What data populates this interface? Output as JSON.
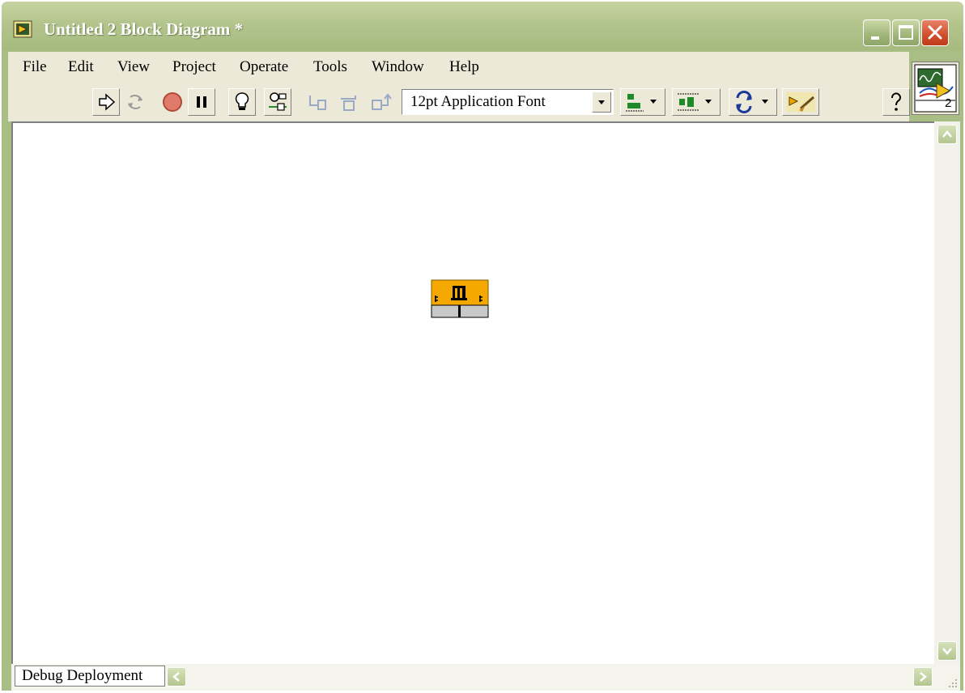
{
  "window": {
    "title": "Untitled 2 Block Diagram *",
    "theme_colors": {
      "titlebar": "#b3c58d",
      "menubar": "#ece9d8",
      "canvas": "#ffffff",
      "close": "#d14e2c"
    }
  },
  "caption_buttons": {
    "minimize_icon": "minimize-icon",
    "maximize_icon": "maximize-icon",
    "close_icon": "close-icon"
  },
  "menubar": {
    "items": [
      {
        "label": "File"
      },
      {
        "label": "Edit"
      },
      {
        "label": "View"
      },
      {
        "label": "Project"
      },
      {
        "label": "Operate"
      },
      {
        "label": "Tools"
      },
      {
        "label": "Window"
      },
      {
        "label": "Help"
      }
    ]
  },
  "toolbar": {
    "buttons": [
      "run-arrow-icon",
      "run-continuously-icon",
      "abort-execution-icon",
      "pause-icon",
      "highlight-execution-icon",
      "retain-wire-values-icon",
      "step-into-icon",
      "step-over-icon",
      "step-out-icon",
      "align-objects-icon",
      "distribute-objects-icon",
      "reorder-icon",
      "clean-up-diagram-icon",
      "context-help-icon"
    ],
    "font_ring": {
      "value": "12pt Application Font"
    }
  },
  "vi_icon": {
    "connector_label": "2"
  },
  "diagram": {
    "node_color": "#f5a800",
    "node_icon": "subvi-node-icon"
  },
  "statusbar": {
    "context_label": "Debug Deployment"
  }
}
